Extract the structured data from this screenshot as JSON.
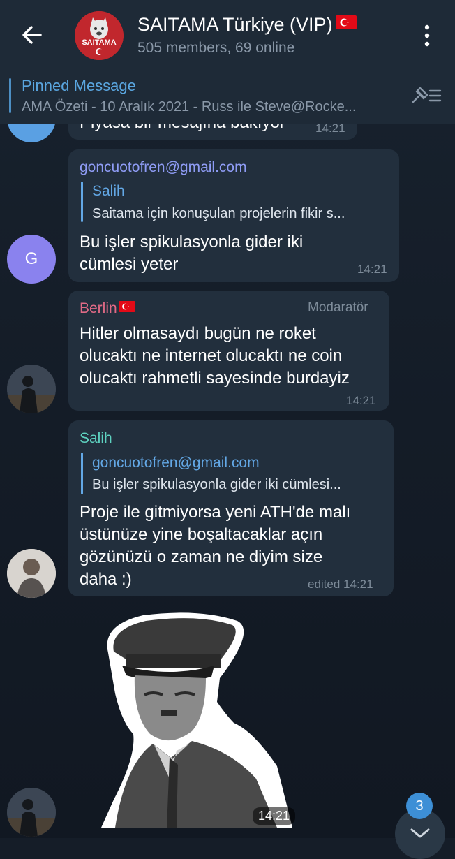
{
  "header": {
    "title": "SAITAMA Türkiye (VIP)",
    "subtitle": "505 members, 69 online",
    "avatar_text": "SAITAMA"
  },
  "pinned": {
    "title": "Pinned Message",
    "text": "AMA Özeti - 10 Aralık 2021 - Russ ile Steve@Rocke..."
  },
  "messages": [
    {
      "partial_text": "Piyasa bir mesajına bakıyor",
      "time": "14:21"
    },
    {
      "sender": "goncuotofren@gmail.com",
      "reply_to": "Salih",
      "reply_text": "Saitama için konuşulan projelerin fikir s...",
      "text": "Bu işler spikulasyonla gider iki\ncümlesi yeter",
      "time": "14:21",
      "avatar_letter": "G"
    },
    {
      "sender": "Berlin",
      "role": "Modaratör",
      "text": "Hitler olmasaydı bugün  ne roket\nolucaktı  ne internet olucaktı ne coin\nolucaktı rahmetli sayesinde burdayiz",
      "time": "14:21"
    },
    {
      "sender": "Salih",
      "reply_to": "goncuotofren@gmail.com",
      "reply_text": "Bu işler spikulasyonla gider iki cümlesi...",
      "text": "Proje ile gitmiyorsa yeni ATH'de malı\nüstünüze yine boşaltacaklar açın\ngözünüzü o zaman ne diyim size\ndaha :)",
      "time": "edited 14:21"
    },
    {
      "sticker_time": "14:21"
    }
  ],
  "scroll_down_badge": "3",
  "colors": {
    "header_bg": "#1e2a37",
    "bubble_bg": "#222f3d",
    "accent": "#5aa6e0",
    "sender_goncu": "#8f9cf5",
    "sender_berlin": "#e06a86",
    "sender_salih": "#5ed2c0"
  }
}
